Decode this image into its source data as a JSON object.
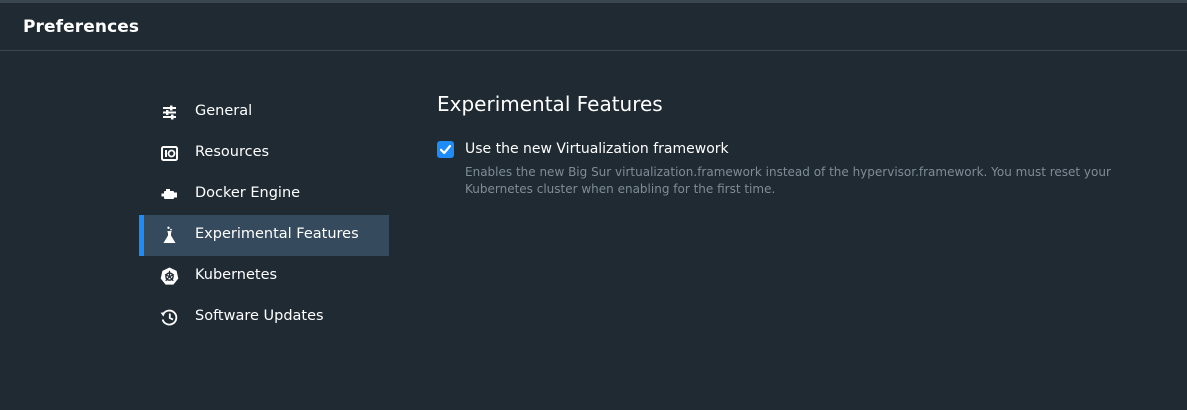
{
  "window": {
    "title": "Preferences"
  },
  "sidebar": {
    "items": [
      {
        "label": "General",
        "icon": "sliders-icon",
        "active": false
      },
      {
        "label": "Resources",
        "icon": "resources-icon",
        "active": false
      },
      {
        "label": "Docker Engine",
        "icon": "engine-icon",
        "active": false
      },
      {
        "label": "Experimental Features",
        "icon": "flask-icon",
        "active": true
      },
      {
        "label": "Kubernetes",
        "icon": "kubernetes-icon",
        "active": false
      },
      {
        "label": "Software Updates",
        "icon": "history-icon",
        "active": false
      }
    ]
  },
  "main": {
    "title": "Experimental Features",
    "options": [
      {
        "checked": true,
        "label": "Use the new Virtualization framework",
        "description": "Enables the new Big Sur virtualization.framework instead of the hypervisor.framework. You must reset your Kubernetes cluster when enabling for the first time."
      }
    ]
  },
  "colors": {
    "background": "#1f2a33",
    "accent": "#1d8cf8",
    "active_item_bg": "#354a5c",
    "muted_text": "#7f8c96"
  }
}
